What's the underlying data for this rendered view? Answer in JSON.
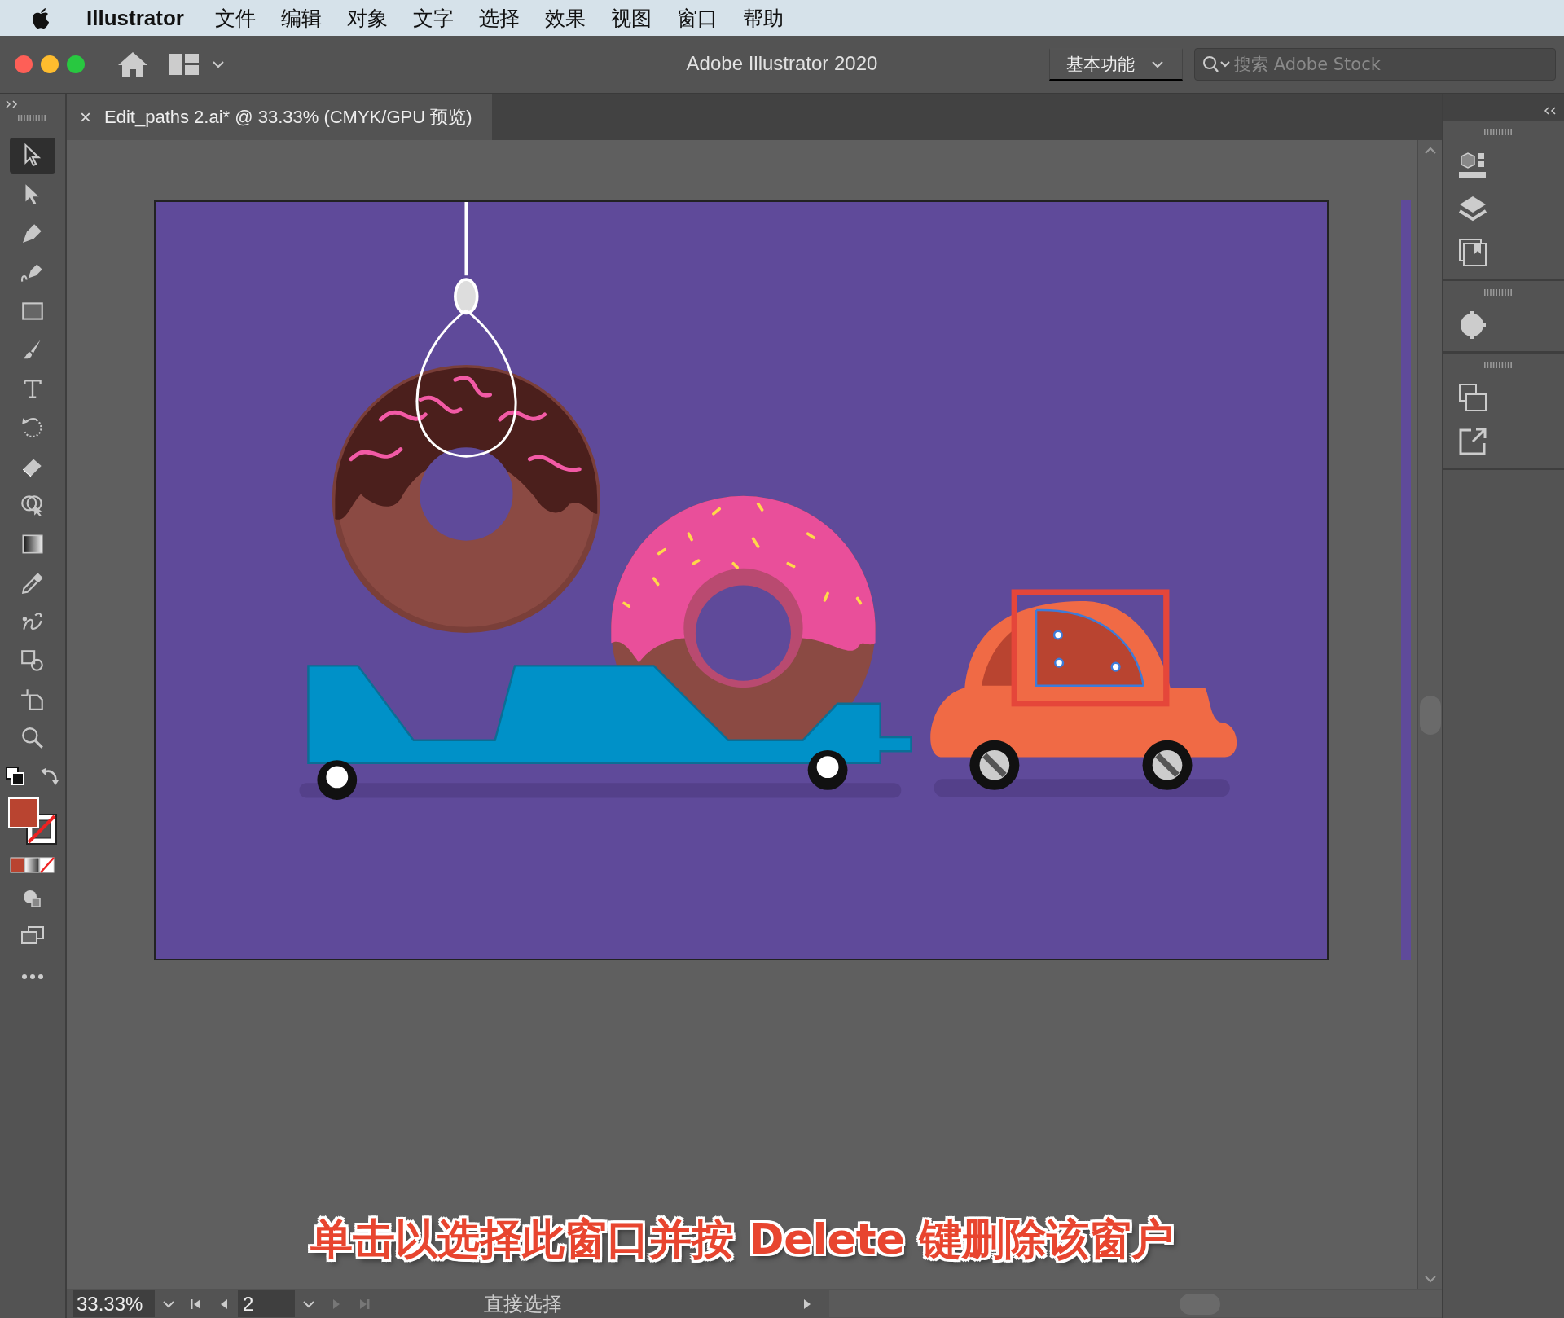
{
  "menu_bar": {
    "app": "Illustrator",
    "items": [
      "文件",
      "编辑",
      "对象",
      "文字",
      "选择",
      "效果",
      "视图",
      "窗口",
      "帮助"
    ]
  },
  "title_bar": {
    "title": "Adobe Illustrator 2020",
    "workspace": "基本功能",
    "search": {
      "placeholder": "搜索 Adobe Stock"
    }
  },
  "document_tab": {
    "close": "×",
    "title": "Edit_paths 2.ai* @ 33.33% (CMYK/GPU 预览)"
  },
  "tools": [
    {
      "kind": "selection",
      "selected": true
    },
    {
      "kind": "direct",
      "selected": false
    },
    {
      "kind": "pen",
      "selected": false
    },
    {
      "kind": "curvature",
      "selected": false
    },
    {
      "kind": "rectangle",
      "selected": false
    },
    {
      "kind": "brush",
      "selected": false
    },
    {
      "kind": "type",
      "selected": false
    },
    {
      "kind": "rotate",
      "selected": false
    },
    {
      "kind": "eraser",
      "selected": false
    },
    {
      "kind": "shapebuilder",
      "selected": false
    },
    {
      "kind": "gradient",
      "selected": false
    },
    {
      "kind": "eyedropper",
      "selected": false
    },
    {
      "kind": "puppet",
      "selected": false
    },
    {
      "kind": "blend",
      "selected": false
    },
    {
      "kind": "artboard",
      "selected": false
    },
    {
      "kind": "zoom",
      "selected": false
    }
  ],
  "caption": "单击以选择此窗口并按 Delete 键删除该窗户",
  "status_bar": {
    "zoom": "33.33%",
    "artboard": "2",
    "tool": "直接选择"
  }
}
